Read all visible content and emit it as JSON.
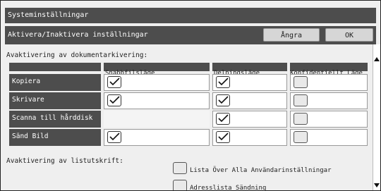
{
  "window": {
    "title": "Systeminställningar",
    "subtitle": "Aktivera/Inaktivera inställningar",
    "cancel_label": "Ångra",
    "ok_label": "OK"
  },
  "doc_archive": {
    "label": "Avaktivering av dokumentarkivering:",
    "columns": [
      "Snabbfilsläge",
      "Delningsläge",
      "Konfidentiellt Läge"
    ],
    "rows": [
      {
        "name": "Kopiera",
        "values": [
          true,
          true,
          false
        ]
      },
      {
        "name": "Skrivare",
        "values": [
          true,
          true,
          false
        ]
      },
      {
        "name": "Scanna till hårddisk",
        "values": [
          null,
          true,
          false
        ]
      },
      {
        "name": "Sänd Bild",
        "values": [
          true,
          true,
          false
        ]
      }
    ]
  },
  "list_print": {
    "label": "Avaktivering av listutskrift:",
    "items": [
      {
        "label": "Lista Över Alla Användarinställningar",
        "checked": false
      },
      {
        "label": "Adresslista Sändning",
        "checked": false
      }
    ]
  }
}
